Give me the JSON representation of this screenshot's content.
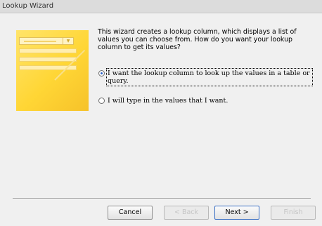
{
  "window": {
    "title": "Lookup Wizard"
  },
  "illustration": {
    "icon": "lookup-list-illustration",
    "colors": {
      "base": "#ffd635",
      "highlight": "#fff3c4"
    }
  },
  "description": "This wizard creates a lookup column, which displays a list of values you can choose from.  How do you want your lookup column to get its values?",
  "options": [
    {
      "label": "I want the lookup column to look up the values in a table or query.",
      "selected": true
    },
    {
      "label": "I will type in the values that I want.",
      "selected": false
    }
  ],
  "buttons": {
    "cancel": "Cancel",
    "back": "< Back",
    "next": "Next >",
    "finish": "Finish"
  },
  "accent": "#3b6fc3"
}
